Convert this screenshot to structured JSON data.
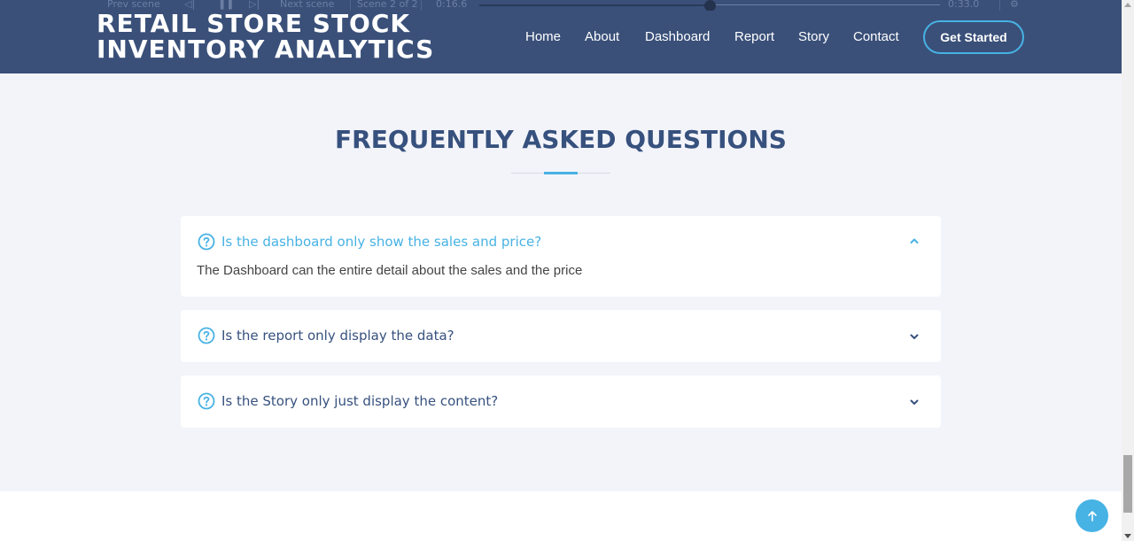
{
  "playback": {
    "prev_scene": "Prev scene",
    "next_scene": "Next scene",
    "scene_counter": "Scene 2 of 2",
    "current_time": "0:16.6",
    "total_time": "0:33.0",
    "progress": 0.5
  },
  "header": {
    "brand_line1": "RETAIL STORE STOCK",
    "brand_line2": "INVENTORY ANALYTICS",
    "nav": [
      "Home",
      "About",
      "Dashboard",
      "Report",
      "Story",
      "Contact"
    ],
    "cta": "Get Started"
  },
  "faq": {
    "title": "FREQUENTLY ASKED QUESTIONS",
    "items": [
      {
        "question": "Is the dashboard only show the sales and price?",
        "answer": "The Dashboard can the entire detail about the sales and the price",
        "expanded": true
      },
      {
        "question": "Is the report only display the data?",
        "expanded": false
      },
      {
        "question": "Is the Story only just display the content?",
        "expanded": false
      }
    ]
  },
  "colors": {
    "header_bg": "#3a5079",
    "accent": "#47b2e4",
    "heading": "#37517e",
    "page_bg": "#f3f4fa"
  },
  "icons": {
    "faq_icon": "question-circle-icon",
    "expanded": "chevron-up-icon",
    "collapsed": "chevron-down-icon",
    "back_to_top": "arrow-up-icon"
  }
}
